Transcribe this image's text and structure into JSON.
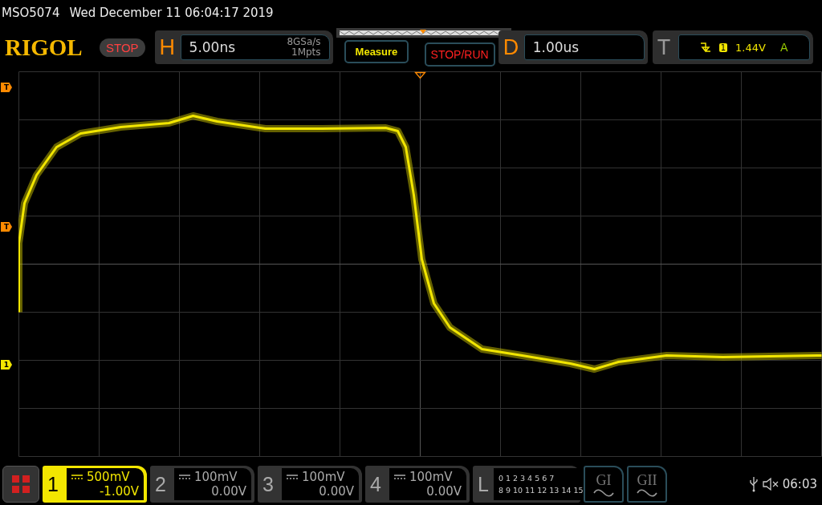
{
  "title_bar": {
    "model": "MSO5074",
    "datetime": "Wed December 11 06:04:17 2019"
  },
  "toolbar": {
    "logo": "RIGOL",
    "run_state": "STOP",
    "horizontal": {
      "label": "H",
      "timebase": "5.00ns",
      "sample_rate": "8GSa/s",
      "memory_depth": "1Mpts"
    },
    "measure_button": "Measure",
    "stop_run_button": "STOP/RUN",
    "delay": {
      "label": "D",
      "value": "1.00us"
    },
    "trigger": {
      "label": "T",
      "source": "1",
      "level": "1.44V",
      "mode": "A"
    }
  },
  "plot": {
    "markers": [
      {
        "kind": "trigger-position",
        "text": "T"
      },
      {
        "kind": "trigger-level",
        "text": "T"
      },
      {
        "kind": "channel-ground",
        "text": "1"
      }
    ]
  },
  "channels": [
    {
      "number": "1",
      "scale": "500mV",
      "offset": "-1.00V",
      "selected": true
    },
    {
      "number": "2",
      "scale": "100mV",
      "offset": "0.00V",
      "selected": false
    },
    {
      "number": "3",
      "scale": "100mV",
      "offset": "0.00V",
      "selected": false
    },
    {
      "number": "4",
      "scale": "100mV",
      "offset": "0.00V",
      "selected": false
    }
  ],
  "logic": {
    "label": "L",
    "bits_row_1": [
      "0",
      "1",
      "2",
      "3",
      "4",
      "5",
      "6",
      "7"
    ],
    "bits_row_2": [
      "8",
      "9",
      "10",
      "11",
      "12",
      "13",
      "14",
      "15"
    ]
  },
  "generators": [
    {
      "label": "GI"
    },
    {
      "label": "GII"
    }
  ],
  "status": {
    "clock": "06:03"
  }
}
